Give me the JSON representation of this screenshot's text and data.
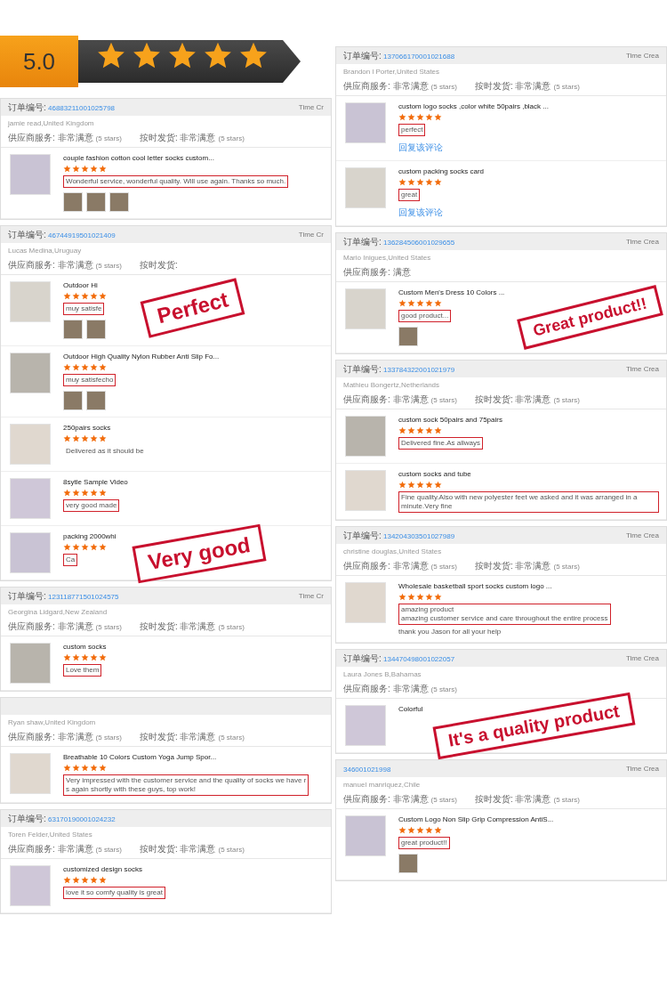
{
  "rating": {
    "score": "5.0",
    "stars": 5
  },
  "columns": [
    {
      "orders": [
        {
          "order_label": "订单编号:",
          "order_no": "46883211001025798",
          "time_label": "Time Cr",
          "buyer": "jamie read,United Kingdom",
          "ratings": [
            {
              "label": "供应商服务:",
              "value": "非常满意",
              "note": "(5 stars)"
            },
            {
              "label": "按时发货:",
              "value": "非常满意",
              "note": "(5 stars)"
            }
          ],
          "items": [
            {
              "title": "couple fashion cotton cool letter socks custom...",
              "stars": 5,
              "comment": [
                "Wonderful service, wonderful quality. Will use again. Thanks so much."
              ],
              "highlighted": true,
              "photos": [
                {
                  "kind": "photo"
                },
                {
                  "kind": "photo"
                },
                {
                  "kind": "photo"
                }
              ]
            }
          ]
        },
        {
          "order_label": "订单编号:",
          "order_no": "46744919501021409",
          "time_label": "Time Cr",
          "buyer": "Lucas Medina,Uruguay",
          "ratings": [
            {
              "label": "供应商服务:",
              "value": "非常满意",
              "note": "(5 stars)"
            },
            {
              "label": "按时发货:"
            }
          ],
          "items": [
            {
              "title": "Outdoor Hi",
              "stars": 5,
              "comment": [
                "muy satisfe"
              ],
              "highlighted": true,
              "photos": [
                {
                  "kind": "photo"
                },
                {
                  "kind": "photo"
                }
              ]
            },
            {
              "title": "Outdoor High Quality Nylon Rubber Anti Slip Fo...",
              "stars": 5,
              "comment": [
                "muy satisfecho"
              ],
              "highlighted": true,
              "photos": [
                {
                  "kind": "photo"
                },
                {
                  "kind": "photo"
                }
              ]
            },
            {
              "title": "250pairs socks",
              "stars": 5,
              "comment": [
                "Delivered as it should be"
              ],
              "highlighted": false
            },
            {
              "title": "8sytle Sample Video",
              "stars": 5,
              "comment": [
                "very good made"
              ],
              "highlighted": true
            },
            {
              "title": "packing 2000whi",
              "stars": 5,
              "comment": [
                "Ca"
              ],
              "highlighted": true
            }
          ]
        },
        {
          "order_label": "订单编号:",
          "order_no": "123118771501024575",
          "time_label": "Time Cr",
          "buyer": "Georgina Lidgard,New Zealand",
          "ratings": [
            {
              "label": "供应商服务:",
              "value": "非常满意",
              "note": "(5 stars)"
            },
            {
              "label": "按时发货:",
              "value": "非常满意",
              "note": "(5 stars)"
            }
          ],
          "items": [
            {
              "title": "custom socks",
              "stars": 5,
              "comment": [
                "Love them"
              ],
              "highlighted": true
            }
          ]
        },
        {
          "buyer": "Ryan shaw,United Kingdom",
          "ratings": [
            {
              "label": "供应商服务:",
              "value": "非常满意",
              "note": "(5 stars)"
            },
            {
              "label": "按时发货:",
              "value": "非常满意",
              "note": "(5 stars)"
            }
          ],
          "items": [
            {
              "title": "Breathable 10 Colors Custom Yoga Jump Spor...",
              "stars": 5,
              "comment": [
                "Very impressed with the customer service and the quality of socks we have r",
                "s again shortly with these guys, top work!"
              ],
              "highlighted": true
            }
          ]
        },
        {
          "order_label": "订单编号:",
          "order_no": "63170190001024232",
          "buyer": "Toren Felder,United States",
          "ratings": [
            {
              "label": "供应商服务:",
              "value": "非常满意",
              "note": "(5 stars)"
            },
            {
              "label": "按时发货:",
              "value": "非常满意",
              "note": "(5 stars)"
            }
          ],
          "items": [
            {
              "title": "customized design socks",
              "stars": 5,
              "comment": [
                "love it so comfy quality is great"
              ],
              "highlighted": true
            }
          ]
        }
      ]
    },
    {
      "orders": [
        {
          "order_label": "订单编号:",
          "order_no": "137066170001021688",
          "time_label": "Time Crea",
          "buyer": "Brandon l Porter,United States",
          "ratings": [
            {
              "label": "供应商服务:",
              "value": "非常满意",
              "note": "(5 stars)"
            },
            {
              "label": "按时发货:",
              "value": "非常满意",
              "note": "(5 stars)"
            }
          ],
          "items": [
            {
              "title": "custom logo socks ,color white 50pairs ,black ...",
              "stars": 5,
              "comment": [
                "perfect"
              ],
              "highlighted": true,
              "reply_link": "回复该评论"
            },
            {
              "title": "custom packing socks card",
              "stars": 5,
              "comment": [
                "great"
              ],
              "highlighted": true,
              "reply_link": "回复该评论"
            }
          ]
        },
        {
          "order_label": "订单编号:",
          "order_no": "136284506001029655",
          "time_label": "Time Crea",
          "buyer": "Mario Inigues,United States",
          "ratings": [
            {
              "label": "供应商服务:",
              "value": "满意"
            }
          ],
          "items": [
            {
              "title": "Custom Men's Dress 10 Colors ...",
              "stars": 5,
              "comment": [
                "good product..."
              ],
              "highlighted": true,
              "photos": [
                {
                  "kind": "photo"
                }
              ]
            }
          ]
        },
        {
          "order_label": "订单编号:",
          "order_no": "133784322001021979",
          "time_label": "Time Crea",
          "buyer": "Mathieu Bongertz,Netherlands",
          "ratings": [
            {
              "label": "供应商服务:",
              "value": "非常满意",
              "note": "(5 stars)"
            },
            {
              "label": "按时发货:",
              "value": "非常满意",
              "note": "(5 stars)"
            }
          ],
          "items": [
            {
              "title": "custom sock 50pairs and 75pairs",
              "stars": 5,
              "comment": [
                "Delivered fine.As allways"
              ],
              "highlighted": true
            },
            {
              "title": "custom socks and tube",
              "stars": 5,
              "comment": [
                "Fine quality.Also with new polyester feet we asked and it was arranged in a minute.Very fine"
              ],
              "highlighted": true
            }
          ]
        },
        {
          "order_label": "订单编号:",
          "order_no": "134204303501027989",
          "time_label": "Time Crea",
          "buyer": "christine douglas,United States",
          "ratings": [
            {
              "label": "供应商服务:",
              "value": "非常满意",
              "note": "(5 stars)"
            },
            {
              "label": "按时发货:",
              "value": "非常满意",
              "note": "(5 stars)"
            }
          ],
          "items": [
            {
              "title": "Wholesale basketball sport socks custom logo ...",
              "stars": 5,
              "comment": [
                "amazing product",
                "amazing customer service and care throughout the entire process"
              ],
              "highlighted": true,
              "extra": "thank you Jason for all your help"
            }
          ]
        },
        {
          "order_label": "订单编号:",
          "order_no": "134470498001022057",
          "time_label": "Time Crea",
          "buyer": "Laura Jones B,Bahamas",
          "ratings": [
            {
              "label": "供应商服务:",
              "value": "非常满意",
              "note": "(5 stars)"
            }
          ],
          "items": [
            {
              "title": "Colorful"
            }
          ]
        },
        {
          "order_no": "346001021998",
          "time_label": "Time Crea",
          "buyer": "manuel manriquez,Chile",
          "ratings": [
            {
              "label": "供应商服务:",
              "value": "非常满意",
              "note": "(5 stars)"
            },
            {
              "label": "按时发货:",
              "value": "非常满意",
              "note": "(5 stars)"
            }
          ],
          "items": [
            {
              "title": "Custom Logo Non Slip Grip Compression AntiS...",
              "stars": 5,
              "comment": [
                "great product!!"
              ],
              "highlighted": true,
              "photos": [
                {
                  "kind": "photo"
                }
              ]
            }
          ]
        }
      ]
    }
  ],
  "stamps": [
    {
      "text": "Perfect"
    },
    {
      "text": "Great product!!"
    },
    {
      "text": "Very good"
    },
    {
      "text": "It's a quality product"
    }
  ]
}
